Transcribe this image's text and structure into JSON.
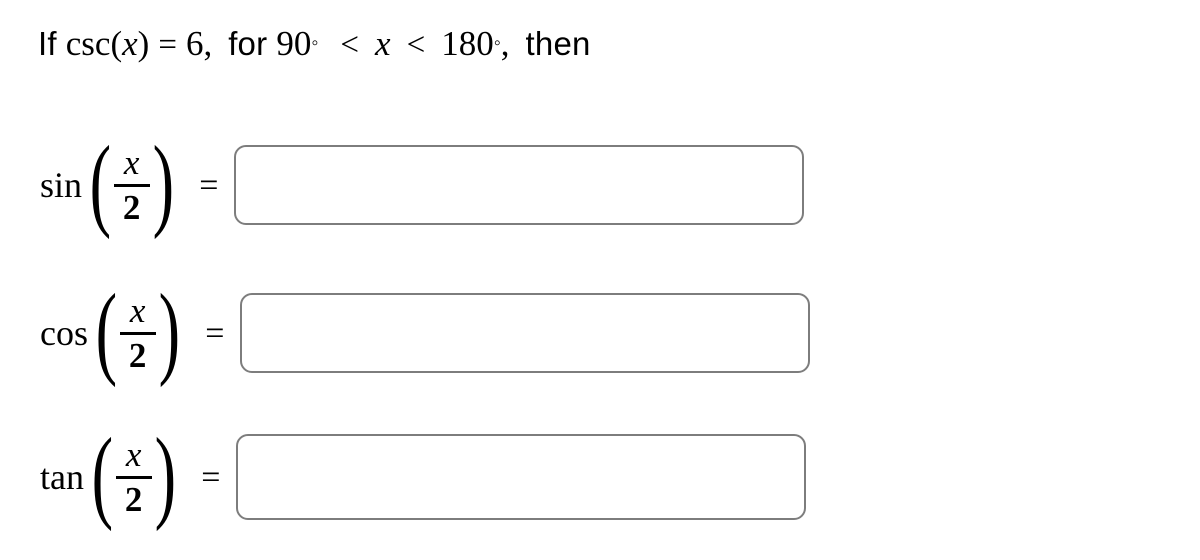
{
  "problem": {
    "intro_if": "If",
    "function_name": "csc",
    "open_paren": "(",
    "variable": "x",
    "close_paren": ")",
    "equals": "=",
    "value": "6",
    "comma": ",",
    "for_word": "for",
    "lower_bound": "90",
    "degree_symbol": "◦",
    "less_than_1": "<",
    "bound_variable": "x",
    "less_than_2": "<",
    "upper_bound": "180",
    "comma_2": ",",
    "then_word": "then"
  },
  "equations": [
    {
      "id": "sin",
      "fn": "sin",
      "open_paren": "(",
      "numerator": "x",
      "denominator": "2",
      "close_paren": ")",
      "equals": "=",
      "answer_value": "",
      "answer_placeholder": ""
    },
    {
      "id": "cos",
      "fn": "cos",
      "open_paren": "(",
      "numerator": "x",
      "denominator": "2",
      "close_paren": ")",
      "equals": "=",
      "answer_value": "",
      "answer_placeholder": ""
    },
    {
      "id": "tan",
      "fn": "tan",
      "open_paren": "(",
      "numerator": "x",
      "denominator": "2",
      "close_paren": ")",
      "equals": "=",
      "answer_value": "",
      "answer_placeholder": ""
    }
  ],
  "colors": {
    "background": "#ffffff",
    "text": "#000000",
    "input_border": "#7d7d7d"
  }
}
